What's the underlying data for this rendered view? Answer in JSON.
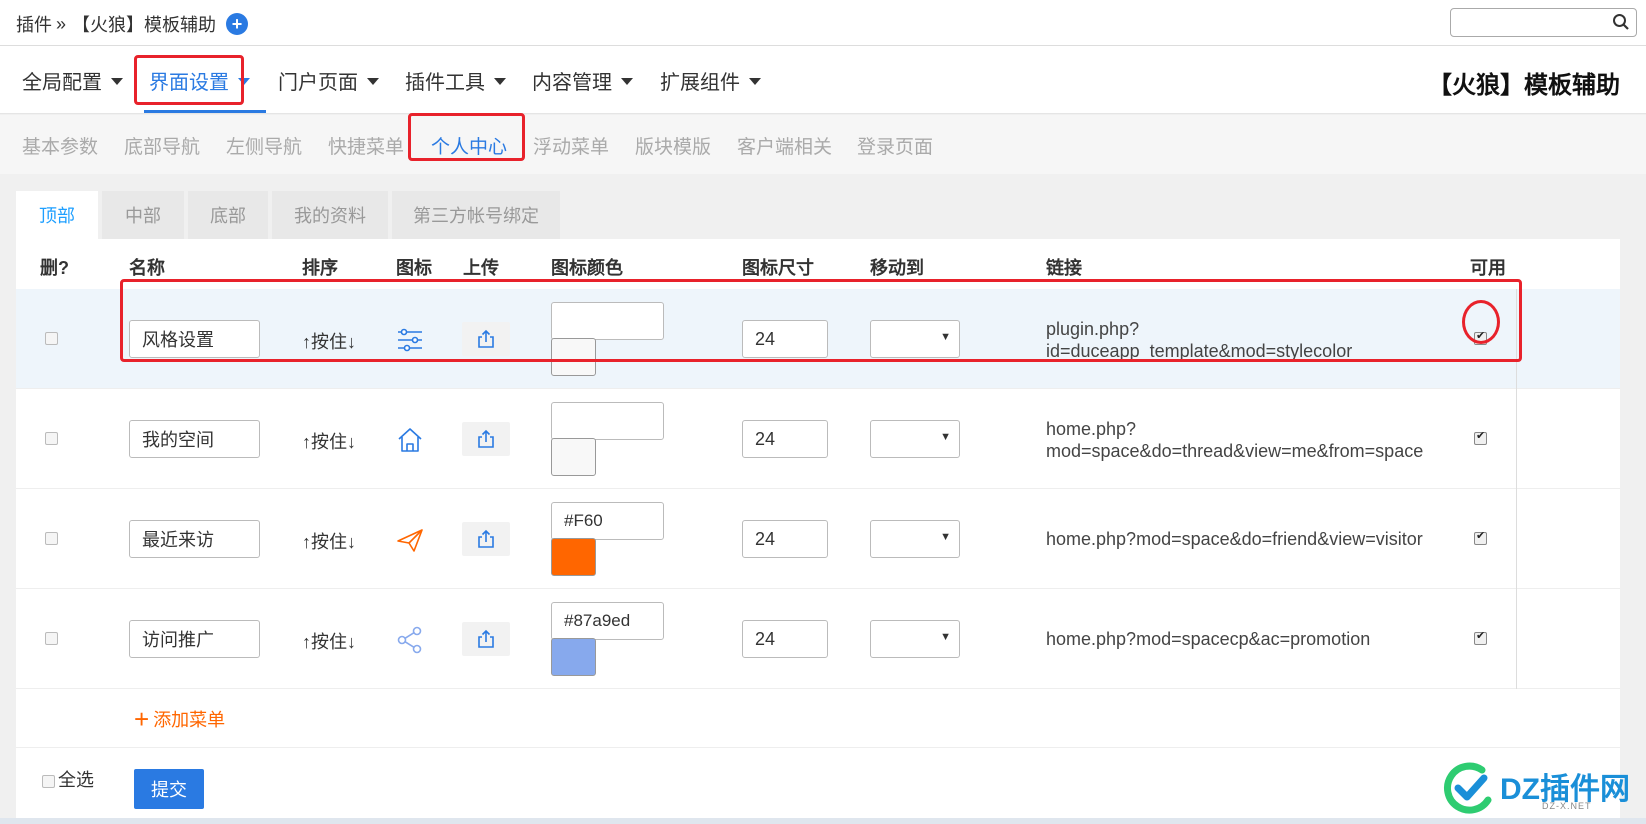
{
  "breadcrumb": {
    "root": "插件",
    "separator": "»",
    "current": "【火狼】模板辅助",
    "add_symbol": "+"
  },
  "search": {
    "value": "",
    "placeholder": ""
  },
  "main_nav": {
    "items": [
      {
        "label": "全局配置",
        "active": false
      },
      {
        "label": "界面设置",
        "active": true
      },
      {
        "label": "门户页面",
        "active": false
      },
      {
        "label": "插件工具",
        "active": false
      },
      {
        "label": "内容管理",
        "active": false
      },
      {
        "label": "扩展组件",
        "active": false
      }
    ],
    "brand": "【火狼】模板辅助"
  },
  "sub_nav": {
    "items": [
      {
        "label": "基本参数"
      },
      {
        "label": "底部导航"
      },
      {
        "label": "左侧导航"
      },
      {
        "label": "快捷菜单"
      },
      {
        "label": "个人中心",
        "active": true
      },
      {
        "label": "浮动菜单"
      },
      {
        "label": "版块模版"
      },
      {
        "label": "客户端相关"
      },
      {
        "label": "登录页面"
      }
    ]
  },
  "tabs": [
    {
      "label": "顶部",
      "active": true
    },
    {
      "label": "中部"
    },
    {
      "label": "底部"
    },
    {
      "label": "我的资料"
    },
    {
      "label": "第三方帐号绑定"
    }
  ],
  "table": {
    "headers": {
      "delete": "删?",
      "name": "名称",
      "order": "排序",
      "icon": "图标",
      "upload": "上传",
      "icon_color": "图标颜色",
      "icon_size": "图标尺寸",
      "move_to": "移动到",
      "link": "链接",
      "enabled": "可用"
    },
    "rows": [
      {
        "name": "风格设置",
        "order": "↑按住↓",
        "icon": "sliders-icon",
        "color": "",
        "swatch": "",
        "size": "24",
        "move_to": "",
        "link_line1": "plugin.php?",
        "link_line2": "id=duceapp_template&mod=stylecolor",
        "enabled": true,
        "deleted": false
      },
      {
        "name": "我的空间",
        "order": "↑按住↓",
        "icon": "home-icon",
        "color": "",
        "swatch": "",
        "size": "24",
        "move_to": "",
        "link_line1": "home.php?",
        "link_line2": "mod=space&do=thread&view=me&from=space",
        "enabled": true,
        "deleted": false
      },
      {
        "name": "最近来访",
        "order": "↑按住↓",
        "icon": "paper-plane-icon",
        "color": "#F60",
        "swatch": "#FF6600",
        "size": "24",
        "move_to": "",
        "link_line1": "home.php?mod=space&do=friend&view=visitor",
        "link_line2": "",
        "enabled": true,
        "deleted": false
      },
      {
        "name": "访问推广",
        "order": "↑按住↓",
        "icon": "share-icon",
        "color": "#87a9ed",
        "swatch": "#87a9ed",
        "size": "24",
        "move_to": "",
        "link_line1": "home.php?mod=spacecp&ac=promotion",
        "link_line2": "",
        "enabled": true,
        "deleted": false
      }
    ]
  },
  "add_menu": {
    "symbol": "+",
    "label": "添加菜单"
  },
  "footer": {
    "select_all": "全选",
    "submit": "提交"
  },
  "watermark": {
    "text": "DZ插件网",
    "sub": "DZ-X.NET"
  },
  "colors": {
    "accent": "#2a7ae2",
    "tab_active": "#1e9fff",
    "highlight": "#e8222b",
    "add": "#ff6600",
    "icon_blue": "#2a7ae2",
    "icon_orange": "#ff6600",
    "icon_lightblue": "#87a9ed"
  }
}
